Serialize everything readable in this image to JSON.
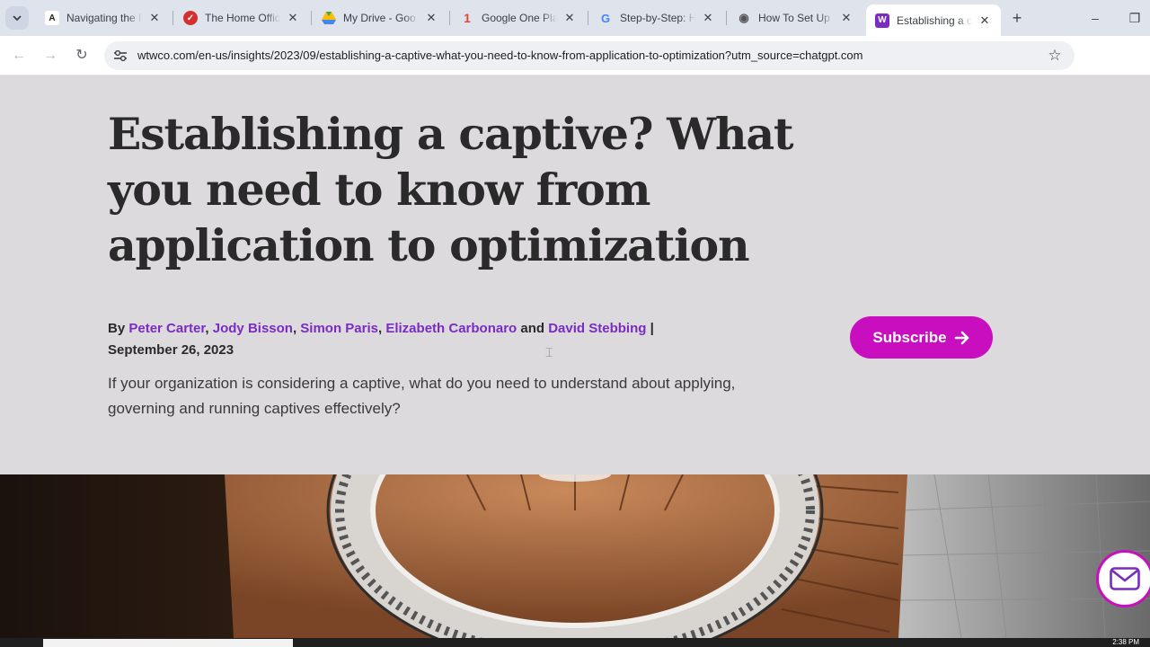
{
  "browser": {
    "tabs": [
      {
        "title": "Navigating the F",
        "icon": "avalara-icon",
        "color": "#222222",
        "glyph": "A"
      },
      {
        "title": "The Home Offic",
        "icon": "red-check-icon",
        "color": "#d32f2f",
        "glyph": "✓"
      },
      {
        "title": "My Drive - Goo",
        "icon": "google-drive-icon",
        "color": "#34a853",
        "glyph": "▲"
      },
      {
        "title": "Google One Pla",
        "icon": "google-one-icon",
        "color": "#4285f4",
        "glyph": "1"
      },
      {
        "title": "Step-by-Step: H",
        "icon": "google-icon",
        "color": "#ffffff",
        "glyph": "G"
      },
      {
        "title": "How To Set Up a",
        "icon": "owl-icon",
        "color": "#555555",
        "glyph": "◉"
      },
      {
        "title": "Establishing a ca",
        "icon": "wtw-icon",
        "color": "#7a2cc0",
        "glyph": "W"
      }
    ],
    "url": "wtwco.com/en-us/insights/2023/09/establishing-a-captive-what-you-need-to-know-from-application-to-optimization?utm_source=chatgpt.com"
  },
  "article": {
    "headline": "Establishing a captive? What you need to know from application to optimization",
    "by": "By",
    "authors": [
      "Peter Carter",
      "Jody Bisson",
      "Simon Paris",
      "Elizabeth Carbonaro",
      "David Stebbing"
    ],
    "and": "and",
    "separator": "|",
    "date": "September 26, 2023",
    "summary": "If your organization is considering a captive, what do you need to understand about applying, governing and running captives effectively?",
    "subscribe_label": "Subscribe"
  },
  "taskbar": {
    "clock": "2:38 PM"
  }
}
